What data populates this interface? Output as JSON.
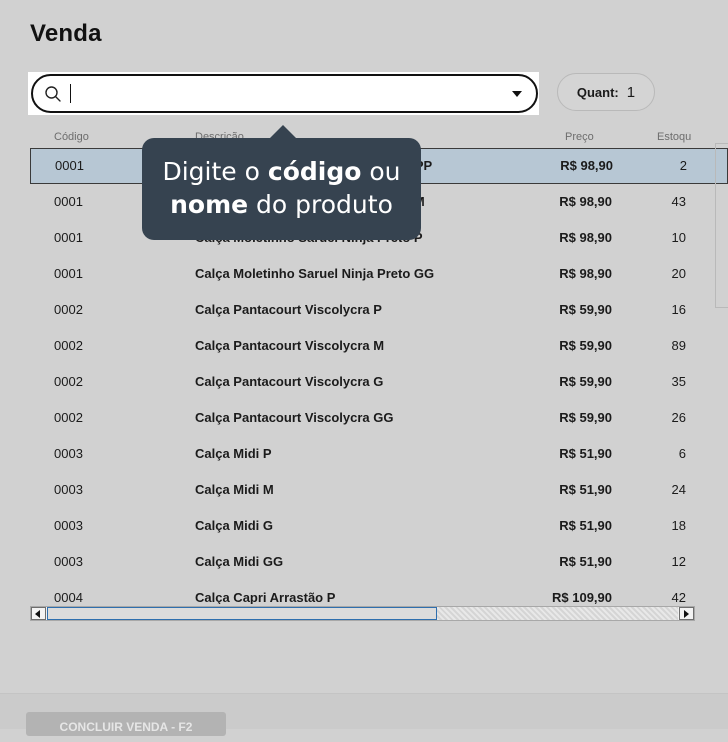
{
  "page": {
    "title": "Venda"
  },
  "search": {
    "placeholder": ""
  },
  "quantity": {
    "label": "Quant:",
    "value": "1"
  },
  "table": {
    "headers": {
      "code": "Código",
      "description": "Descrição",
      "price": "Preço",
      "stock": "Estoqu"
    },
    "rows": [
      {
        "code": "0001",
        "description": "Calça Moletinho Saruel Ninja Preto PP",
        "price": "R$ 98,90",
        "stock": "2",
        "selected": true
      },
      {
        "code": "0001",
        "description": "Calça Moletinho Saruel Ninja Preto M",
        "price": "R$ 98,90",
        "stock": "43"
      },
      {
        "code": "0001",
        "description": "Calça Moletinho Saruel Ninja Preto P",
        "price": "R$ 98,90",
        "stock": "10"
      },
      {
        "code": "0001",
        "description": "Calça Moletinho Saruel Ninja Preto GG",
        "price": "R$ 98,90",
        "stock": "20"
      },
      {
        "code": "0002",
        "description": "Calça Pantacourt Viscolycra P",
        "price": "R$ 59,90",
        "stock": "16"
      },
      {
        "code": "0002",
        "description": "Calça Pantacourt Viscolycra M",
        "price": "R$ 59,90",
        "stock": "89"
      },
      {
        "code": "0002",
        "description": "Calça Pantacourt Viscolycra G",
        "price": "R$ 59,90",
        "stock": "35"
      },
      {
        "code": "0002",
        "description": "Calça Pantacourt Viscolycra GG",
        "price": "R$ 59,90",
        "stock": "26"
      },
      {
        "code": "0003",
        "description": "Calça Midi P",
        "price": "R$ 51,90",
        "stock": "6"
      },
      {
        "code": "0003",
        "description": "Calça Midi M",
        "price": "R$ 51,90",
        "stock": "24"
      },
      {
        "code": "0003",
        "description": "Calça Midi G",
        "price": "R$ 51,90",
        "stock": "18"
      },
      {
        "code": "0003",
        "description": "Calça Midi GG",
        "price": "R$ 51,90",
        "stock": "12"
      },
      {
        "code": "0004",
        "description": "Calça Capri Arrastão P",
        "price": "R$ 109,90",
        "stock": "42"
      }
    ]
  },
  "tooltip": {
    "part1": "Digite o ",
    "bold1": "código",
    "part2": " ou",
    "bold2": "nome",
    "part3": " do produto"
  },
  "footer": {
    "finish_label": "CONCLUIR VENDA - F2"
  }
}
